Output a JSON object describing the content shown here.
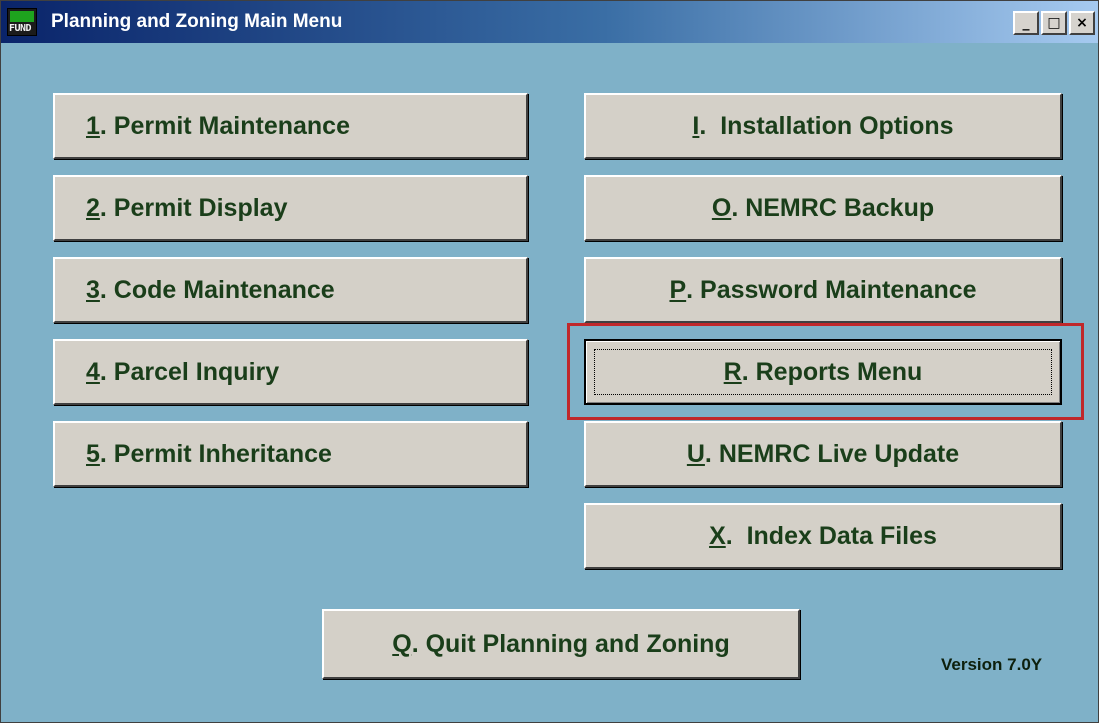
{
  "window": {
    "title": "Planning and Zoning Main Menu",
    "icon_top": "NEMRC",
    "icon_bottom": "FUND",
    "controls": {
      "minimize": "_",
      "maximize": "□",
      "close": "×"
    }
  },
  "left_menu": [
    {
      "key": "1",
      "label": ". Permit Maintenance"
    },
    {
      "key": "2",
      "label": ". Permit Display"
    },
    {
      "key": "3",
      "label": ". Code Maintenance"
    },
    {
      "key": "4",
      "label": ". Parcel Inquiry"
    },
    {
      "key": "5",
      "label": ". Permit Inheritance"
    }
  ],
  "right_menu": [
    {
      "key": "I",
      "label": ".  Installation Options"
    },
    {
      "key": "O",
      "label": ". NEMRC Backup"
    },
    {
      "key": "P",
      "label": ". Password Maintenance"
    },
    {
      "key": "R",
      "label": ". Reports Menu",
      "focused": true
    },
    {
      "key": "U",
      "label": ". NEMRC Live Update"
    },
    {
      "key": "X",
      "label": ".  Index Data Files"
    }
  ],
  "quit": {
    "key": "Q",
    "label": ". Quit Planning and Zoning"
  },
  "version": "Version 7.0Y",
  "colors": {
    "background": "#7fb1c8",
    "button_face": "#d4d0c8",
    "button_text": "#1a3e1a",
    "highlight": "#c0282b"
  }
}
